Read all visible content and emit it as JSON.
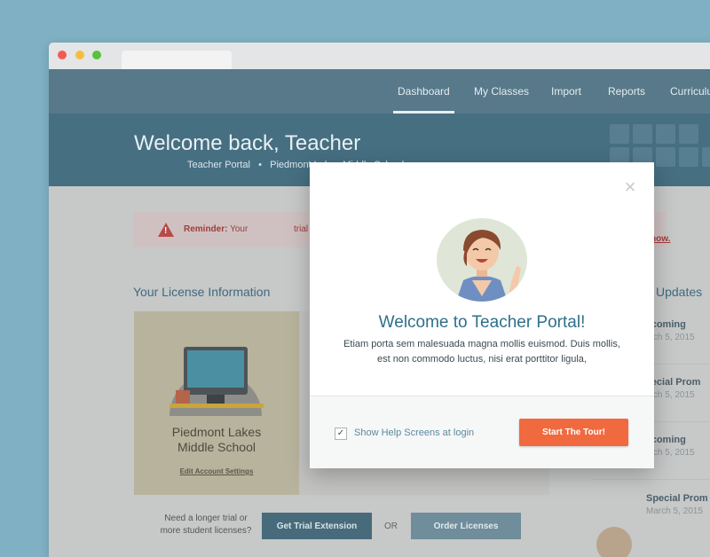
{
  "nav": {
    "items": [
      "Dashboard",
      "My Classes",
      "Import",
      "Reports",
      "Curriculum"
    ]
  },
  "hero": {
    "title": "Welcome back, Teacher",
    "crumb_portal": "Teacher Portal",
    "crumb_sep": "•",
    "crumb_school": "Piedmont Lakes Middle School"
  },
  "reminder": {
    "label": "Reminder:",
    "text": "Your",
    "text2": "trial",
    "link": "r now."
  },
  "license": {
    "title": "Your License Information",
    "school_line1": "Piedmont Lakes",
    "school_line2": "Middle School",
    "edit_link": "Edit Account Settings",
    "longer_line1": "Need a longer trial or",
    "longer_line2": "more student licenses?",
    "trial_button": "Get Trial Extension",
    "or": "OR",
    "order_button": "Order Licenses"
  },
  "updates": {
    "title": "l Updates",
    "items": [
      {
        "title": "pcoming",
        "date": "arch 5, 2015"
      },
      {
        "title": "pecial Prom",
        "date": "arch 5, 2015"
      },
      {
        "title": "pcoming",
        "date": "arch 5, 2015"
      },
      {
        "title": "Special Prom",
        "date": "March 5, 2015"
      }
    ]
  },
  "modal": {
    "title": "Welcome to Teacher Portal!",
    "body": "Etiam porta sem malesuada magna mollis euismod. Duis mollis, est non commodo luctus, nisi erat porttitor ligula,",
    "checkbox_checked": true,
    "checkbox_mark": "✓",
    "checkbox_label": "Show Help Screens at login",
    "tour_button": "Start The Tour!",
    "close_glyph": "×"
  },
  "colors": {
    "background": "#7fb0c4",
    "nav": "#57798a",
    "hero": "#466f82",
    "accent": "#f1693f",
    "modal_title": "#2f6f8c",
    "reminder": "#b94a48"
  },
  "icons": [
    "close-icon",
    "warning-icon",
    "check-icon"
  ]
}
